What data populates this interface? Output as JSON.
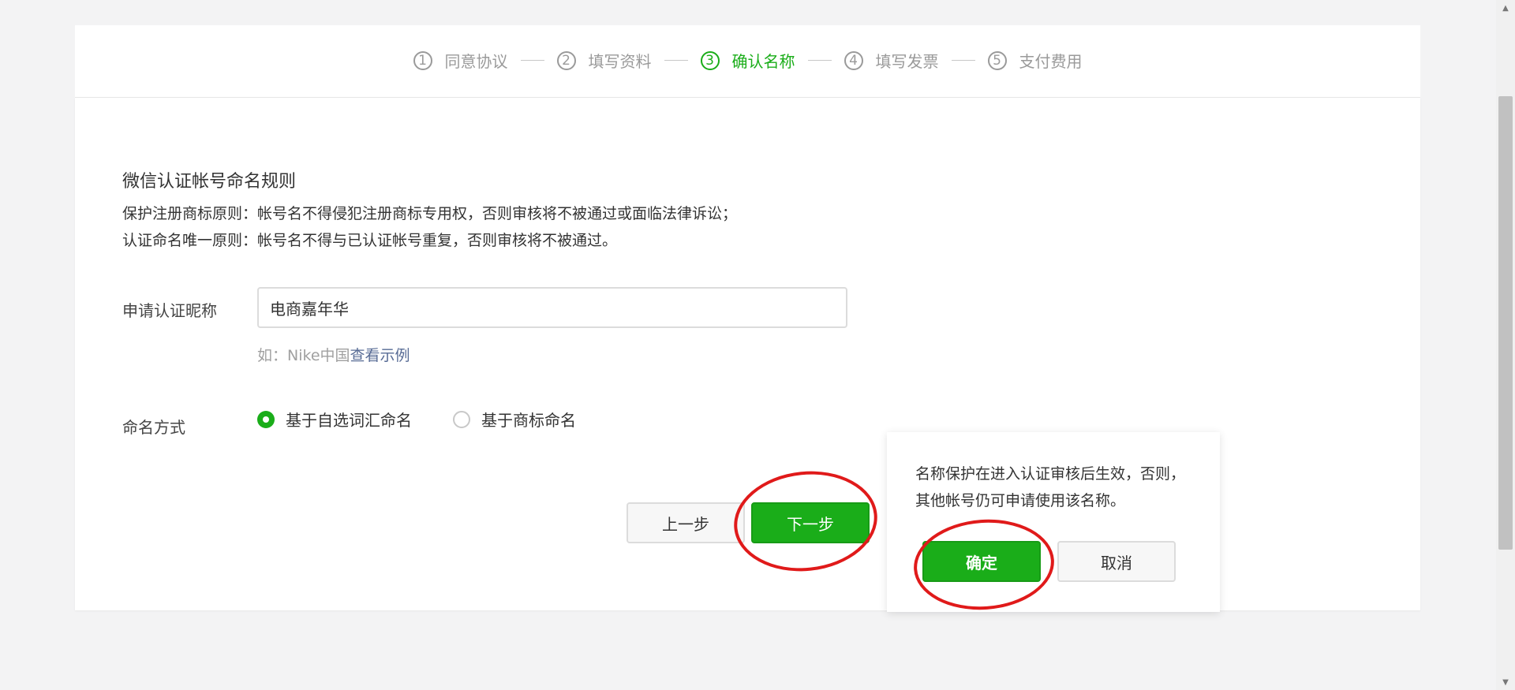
{
  "stepper": {
    "steps": [
      {
        "num": "1",
        "label": "同意协议"
      },
      {
        "num": "2",
        "label": "填写资料"
      },
      {
        "num": "3",
        "label": "确认名称"
      },
      {
        "num": "4",
        "label": "填写发票"
      },
      {
        "num": "5",
        "label": "支付费用"
      }
    ],
    "active_step": 3
  },
  "rules": {
    "title": "微信认证帐号命名规则",
    "line1": "保护注册商标原则：帐号名不得侵犯注册商标专用权，否则审核将不被通过或面临法律诉讼；",
    "line2": "认证命名唯一原则：帐号名不得与已认证帐号重复，否则审核将不被通过。"
  },
  "form": {
    "nickname_label": "申请认证昵称",
    "nickname_value": "电商嘉年华",
    "hint_prefix": "如：Nike中国",
    "hint_link": "查看示例",
    "method_label": "命名方式",
    "method_options": [
      {
        "label": "基于自选词汇命名",
        "checked": true
      },
      {
        "label": "基于商标命名",
        "checked": false
      }
    ]
  },
  "buttons": {
    "prev": "上一步",
    "next": "下一步"
  },
  "popover": {
    "text": "名称保护在进入认证审核后生效，否则，其他帐号仍可申请使用该名称。",
    "confirm": "确定",
    "cancel": "取消"
  },
  "colors": {
    "accent": "#1aad19",
    "annotation": "#e01a1a",
    "link": "#576b95"
  },
  "icons": {
    "scroll_up": "triangle-up-icon",
    "scroll_down": "triangle-down-icon"
  }
}
